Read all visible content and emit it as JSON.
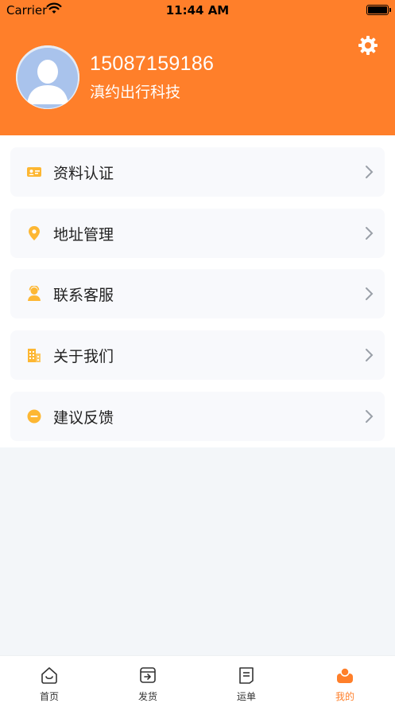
{
  "status_bar": {
    "carrier": "Carrier",
    "time": "11:44 AM"
  },
  "profile": {
    "phone": "15087159186",
    "company": "滇约出行科技"
  },
  "menu": {
    "items": [
      {
        "label": "资料认证",
        "icon": "id-card-icon"
      },
      {
        "label": "地址管理",
        "icon": "location-pin-icon"
      },
      {
        "label": "联系客服",
        "icon": "customer-service-icon"
      },
      {
        "label": "关于我们",
        "icon": "building-icon"
      },
      {
        "label": "建议反馈",
        "icon": "feedback-icon"
      }
    ]
  },
  "tabbar": {
    "tabs": [
      {
        "label": "首页",
        "icon": "home-icon"
      },
      {
        "label": "发货",
        "icon": "ship-box-icon"
      },
      {
        "label": "运单",
        "icon": "waybill-icon"
      },
      {
        "label": "我的",
        "icon": "profile-icon",
        "active": true
      }
    ]
  },
  "colors": {
    "accent": "#ff7f2a",
    "icon_yellow": "#fdb733"
  }
}
